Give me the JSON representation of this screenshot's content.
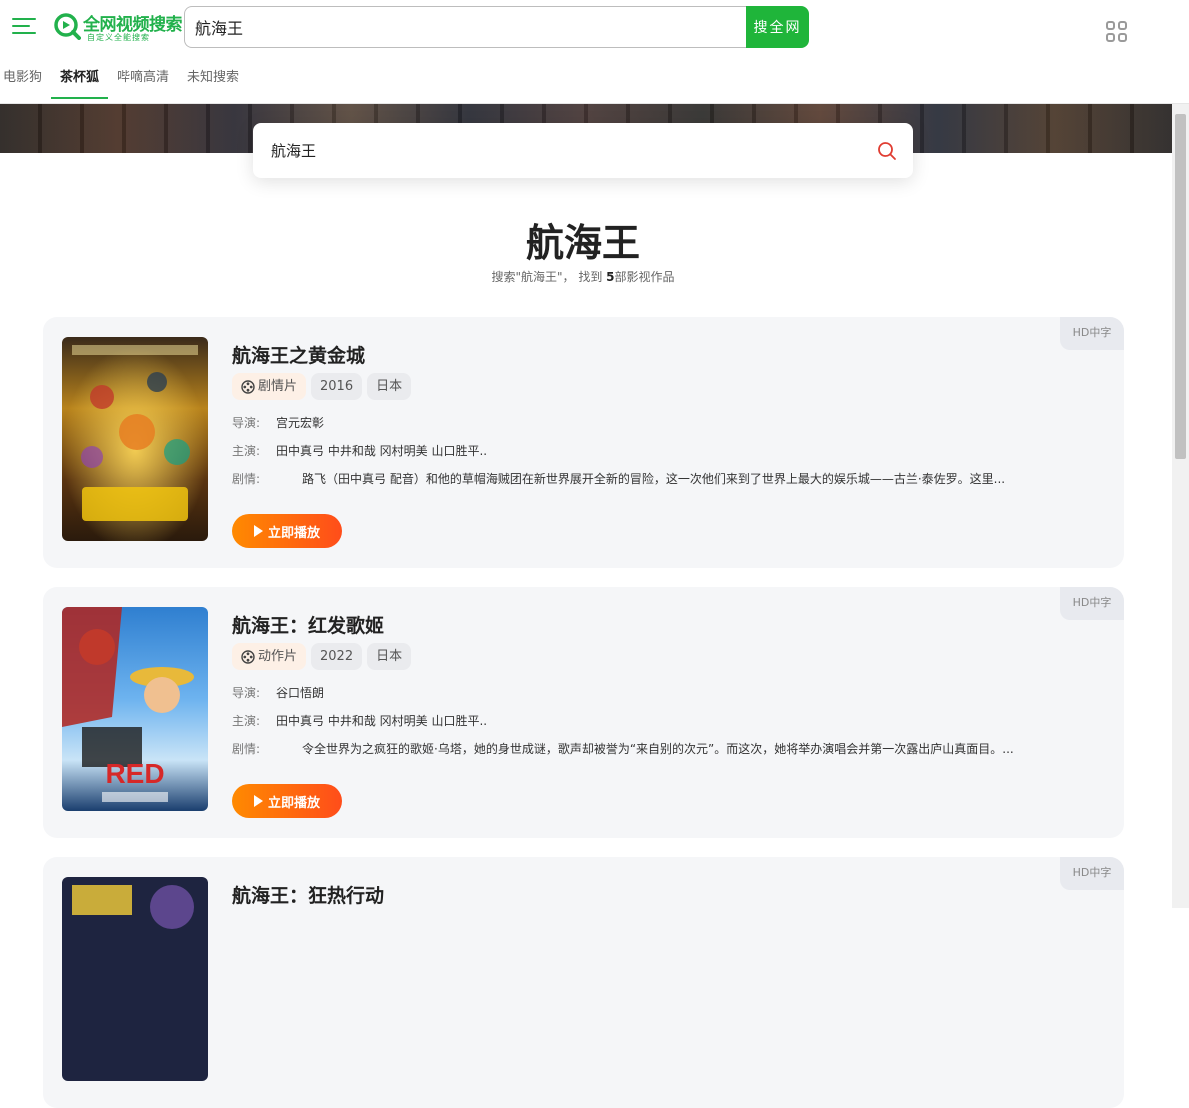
{
  "header": {
    "logo_text": "全网视频搜索",
    "logo_subtitle": "自定义全能搜索",
    "search_value": "航海王",
    "search_button": "搜全网",
    "source_tabs": [
      {
        "label": "电影狗"
      },
      {
        "label": "茶杯狐"
      },
      {
        "label": "哔嘀高清"
      },
      {
        "label": "未知搜索"
      }
    ],
    "active_tab": "茶杯狐"
  },
  "search_box": {
    "value": "航海王"
  },
  "results": {
    "title": "航海王",
    "summary_prefix": "搜索\"航海王\"， 找到 ",
    "count": "5",
    "summary_suffix": "部影视作品"
  },
  "labels": {
    "director": "导演:",
    "cast": "主演:",
    "plot": "剧情:",
    "play": "立即播放",
    "hd": "HD中字"
  },
  "movies": [
    {
      "title": "航海王之黄金城",
      "genre": "剧情片",
      "year": "2016",
      "region": "日本",
      "director": "宫元宏彰",
      "cast": "田中真弓 中井和哉 冈村明美 山口胜平..",
      "plot": "路飞（田中真弓 配音）和他的草帽海贼团在新世界展开全新的冒险，这一次他们来到了世界上最大的娱乐城——古兰·泰佐罗。这里...",
      "quality": "HD中字"
    },
    {
      "title": "航海王：红发歌姬",
      "genre": "动作片",
      "year": "2022",
      "region": "日本",
      "director": "谷口悟朗",
      "cast": "田中真弓 中井和哉 冈村明美 山口胜平..",
      "plot": "令全世界为之疯狂的歌姬·乌塔，她的身世成谜，歌声却被誉为“来自别的次元”。而这次，她将举办演唱会并第一次露出庐山真面目。...",
      "quality": "HD中字"
    },
    {
      "title": "航海王：狂热行动",
      "quality": "HD中字"
    }
  ],
  "colors": {
    "brand_green": "#22b14c",
    "search_button": "#1fb53a",
    "play_gradient_start": "#ff8a00",
    "play_gradient_end": "#ff4d1a",
    "card_background": "#f5f6f8"
  },
  "icons": {
    "menu": "hamburger-menu-icon",
    "logo": "magnifier-logo-icon",
    "apps": "grid-apps-icon",
    "search": "search-icon",
    "genre": "film-reel-icon",
    "play": "play-icon"
  }
}
